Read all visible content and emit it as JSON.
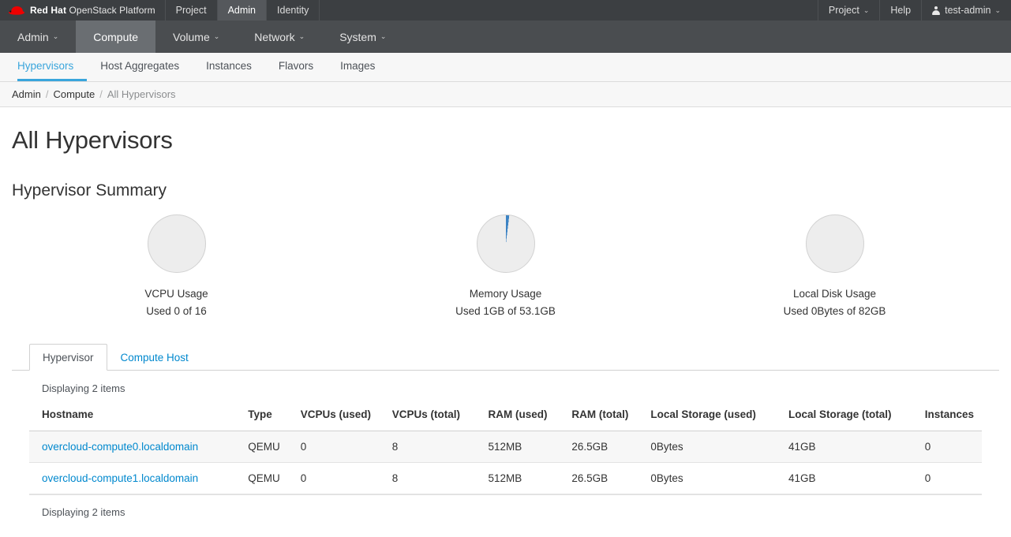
{
  "topbar": {
    "brand_bold": "Red Hat",
    "brand_rest": " OpenStack Platform",
    "nav": [
      {
        "label": "Project",
        "active": false
      },
      {
        "label": "Admin",
        "active": true
      },
      {
        "label": "Identity",
        "active": false
      }
    ],
    "right": {
      "project_label": "Project",
      "help_label": "Help",
      "user_label": "test-admin",
      "caret": "⌄"
    }
  },
  "modnav": [
    {
      "label": "Admin",
      "caret": true,
      "active": false
    },
    {
      "label": "Compute",
      "caret": false,
      "active": true
    },
    {
      "label": "Volume",
      "caret": true,
      "active": false
    },
    {
      "label": "Network",
      "caret": true,
      "active": false
    },
    {
      "label": "System",
      "caret": true,
      "active": false
    }
  ],
  "subnav": [
    {
      "label": "Hypervisors",
      "active": true
    },
    {
      "label": "Host Aggregates",
      "active": false
    },
    {
      "label": "Instances",
      "active": false
    },
    {
      "label": "Flavors",
      "active": false
    },
    {
      "label": "Images",
      "active": false
    }
  ],
  "breadcrumb": {
    "item1": "Admin",
    "sep1": "/",
    "item2": "Compute",
    "sep2": "/",
    "current": "All Hypervisors"
  },
  "page": {
    "title": "All Hypervisors",
    "section_title": "Hypervisor Summary"
  },
  "chart_data": [
    {
      "type": "pie",
      "title": "VCPU Usage",
      "subtitle": "Used 0 of 16",
      "used": 0,
      "total": 16,
      "unit": "vCPU",
      "percent": 0,
      "slice_color": "#3c83c4",
      "track_color": "#ededed",
      "border_color": "#d2d2d2",
      "legend": "none"
    },
    {
      "type": "pie",
      "title": "Memory Usage",
      "subtitle": "Used 1GB of 53.1GB",
      "used": 1,
      "total": 53.1,
      "unit": "GB",
      "percent": 1.9,
      "slice_color": "#3c83c4",
      "track_color": "#ededed",
      "border_color": "#d2d2d2",
      "legend": "none"
    },
    {
      "type": "pie",
      "title": "Local Disk Usage",
      "subtitle": "Used 0Bytes of 82GB",
      "used": 0,
      "total": 82,
      "unit": "GB",
      "percent": 0,
      "slice_color": "#3c83c4",
      "track_color": "#ededed",
      "border_color": "#d2d2d2",
      "legend": "none"
    }
  ],
  "navtabs": [
    {
      "label": "Hypervisor",
      "active": true
    },
    {
      "label": "Compute Host",
      "active": false
    }
  ],
  "table": {
    "count_top": "Displaying 2 items",
    "count_bottom": "Displaying 2 items",
    "headers": [
      "Hostname",
      "Type",
      "VCPUs (used)",
      "VCPUs (total)",
      "RAM (used)",
      "RAM (total)",
      "Local Storage (used)",
      "Local Storage (total)",
      "Instances"
    ],
    "rows": [
      {
        "hostname": "overcloud-compute0.localdomain",
        "type": "QEMU",
        "vcpus_used": "0",
        "vcpus_total": "8",
        "ram_used": "512MB",
        "ram_total": "26.5GB",
        "local_used": "0Bytes",
        "local_total": "41GB",
        "instances": "0"
      },
      {
        "hostname": "overcloud-compute1.localdomain",
        "type": "QEMU",
        "vcpus_used": "0",
        "vcpus_total": "8",
        "ram_used": "512MB",
        "ram_total": "26.5GB",
        "local_used": "0Bytes",
        "local_total": "41GB",
        "instances": "0"
      }
    ]
  }
}
